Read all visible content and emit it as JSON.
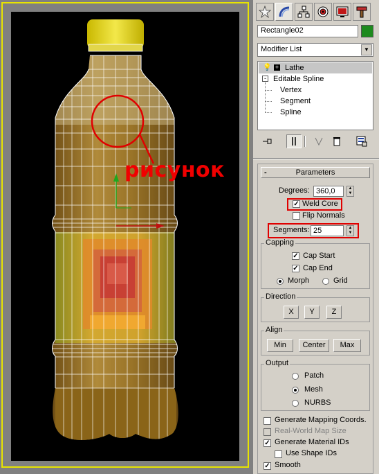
{
  "viewport": {
    "annotation": "рисунок"
  },
  "panel": {
    "tabs": [
      "create-icon",
      "modify-icon",
      "hierarchy-icon",
      "motion-icon",
      "display-icon",
      "utilities-icon"
    ],
    "object_name": "Rectangle02",
    "object_color": "#1d8a1d",
    "modifier_list": "Modifier List",
    "stack": [
      {
        "label": "Lathe"
      },
      {
        "label": "Editable Spline"
      },
      {
        "label": "Vertex"
      },
      {
        "label": "Segment"
      },
      {
        "label": "Spline"
      }
    ],
    "parameters": {
      "title": "Parameters",
      "minus": "-",
      "degrees_label": "Degrees:",
      "degrees_value": "360,0",
      "weld_core": "Weld Core",
      "flip_normals": "Flip Normals",
      "segments_label": "Segments:",
      "segments_value": "25",
      "capping": {
        "title": "Capping",
        "cap_start": "Cap Start",
        "cap_end": "Cap End",
        "morph": "Morph",
        "grid": "Grid"
      },
      "direction": {
        "title": "Direction",
        "x": "X",
        "y": "Y",
        "z": "Z"
      },
      "align": {
        "title": "Align",
        "min": "Min",
        "center": "Center",
        "max": "Max"
      },
      "output": {
        "title": "Output",
        "patch": "Patch",
        "mesh": "Mesh",
        "nurbs": "NURBS"
      },
      "gen_mapping": "Generate Mapping Coords.",
      "real_world": "Real-World Map Size",
      "gen_material": "Generate Material IDs",
      "use_shape": "Use Shape IDs",
      "smooth": "Smooth"
    }
  }
}
